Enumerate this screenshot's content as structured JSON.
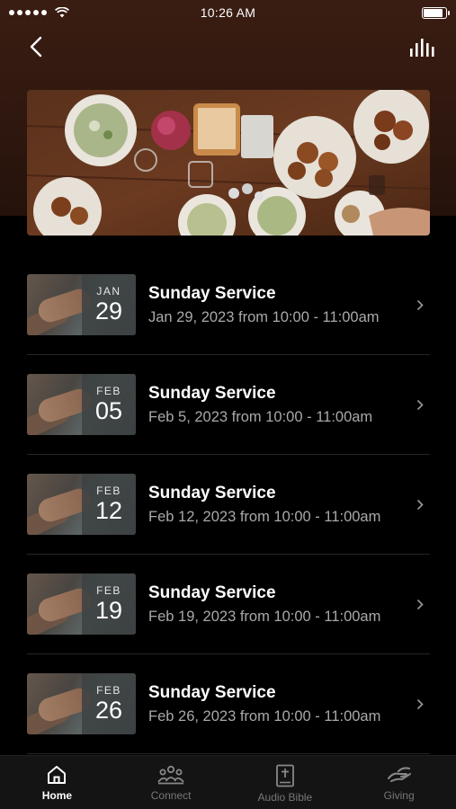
{
  "status_bar": {
    "time": "10:26 AM",
    "signal_icon": "signal-dots-icon",
    "wifi_icon": "wifi-icon",
    "battery_level": 0.92
  },
  "nav": {
    "back_icon": "chevron-left-icon",
    "audio_icon": "audio-bars-icon"
  },
  "hero": {
    "image": "table-of-food-photo"
  },
  "events": [
    {
      "month": "JAN",
      "day": "29",
      "title": "Sunday Service",
      "subtitle": "Jan 29, 2023 from 10:00 - 11:00am"
    },
    {
      "month": "FEB",
      "day": "05",
      "title": "Sunday Service",
      "subtitle": "Feb 5, 2023 from 10:00 - 11:00am"
    },
    {
      "month": "FEB",
      "day": "12",
      "title": "Sunday Service",
      "subtitle": "Feb 12, 2023 from 10:00 - 11:00am"
    },
    {
      "month": "FEB",
      "day": "19",
      "title": "Sunday Service",
      "subtitle": "Feb 19, 2023 from 10:00 - 11:00am"
    },
    {
      "month": "FEB",
      "day": "26",
      "title": "Sunday Service",
      "subtitle": "Feb 26, 2023 from 10:00 - 11:00am"
    }
  ],
  "tabs": [
    {
      "label": "Home",
      "icon": "home-icon",
      "active": true
    },
    {
      "label": "Connect",
      "icon": "people-icon",
      "active": false
    },
    {
      "label": "Audio Bible",
      "icon": "bible-icon",
      "active": false
    },
    {
      "label": "Giving",
      "icon": "giving-hand-icon",
      "active": false
    }
  ],
  "colors": {
    "header": "#3a1d12",
    "background": "#000000",
    "tabbar": "#141414",
    "subtitle": "#a9a9a9"
  }
}
